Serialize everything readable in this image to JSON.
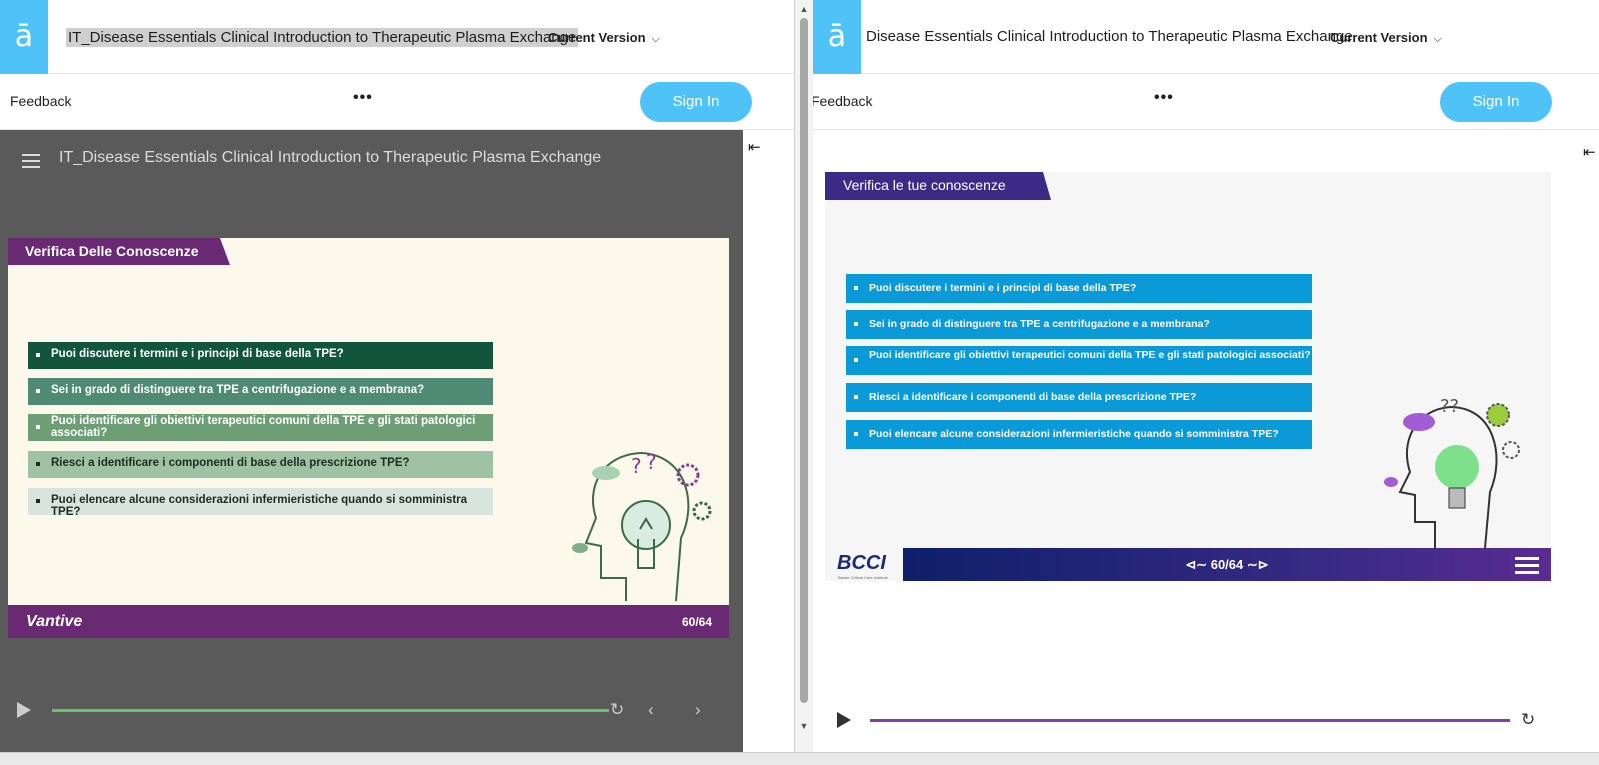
{
  "left": {
    "title": "IT_Disease Essentials Clinical Introduction to Therapeutic Plasma Exchange",
    "version": "Current Version",
    "feedback": "Feedback",
    "more": "•••",
    "sign_in": "Sign In",
    "player_title": "IT_Disease Essentials Clinical Introduction to Therapeutic Plasma Exchange",
    "slide": {
      "heading": "Verifica Delle Conoscenze",
      "questions": [
        "Puoi discutere i termini e i principi di base della TPE?",
        "Sei in grado di distinguere tra TPE a centrifugazione  e a membrana?",
        "Puoi identificare gli obiettivi terapeutici comuni della TPE e gli stati patologici associati?",
        "Riesci a identificare i componenti di base della prescrizione TPE?",
        "Puoi elencare alcune considerazioni infermieristiche quando si somministra TPE?"
      ],
      "question_colors": [
        "#12553d",
        "#4f8a74",
        "#6d9e76",
        "#9ec2a3",
        "#d7e5dc"
      ],
      "question_text_colors": [
        "#ffffff",
        "#ffffff",
        "#ffffff",
        "#1d2d24",
        "#1d2d24"
      ],
      "brand": "Vantive",
      "page": "60/64"
    }
  },
  "right": {
    "title": "Disease Essentials Clinical Introduction to Therapeutic Plasma Exchange",
    "version": "Current Version",
    "feedback": "Feedback",
    "more": "•••",
    "sign_in": "Sign In",
    "slide": {
      "heading": "Verifica le tue conoscenze",
      "questions": [
        "Puoi discutere i termini e i principi di base della TPE?",
        "Sei in grado di distinguere tra TPE a centrifugazione  e a membrana?",
        "Puoi identificare gli obiettivi terapeutici comuni della TPE e gli stati patologici associati?",
        "Riesci a identificare i componenti di base della prescrizione TPE?",
        "Puoi elencare alcune considerazioni infermieristiche quando si somministra TPE?"
      ],
      "brand": "BCCI",
      "brand_sub": "Baxter Critical Care Institute",
      "page": "60/64"
    }
  },
  "colors": {
    "accent": "#4fc3f7",
    "left_tab": "#6a2a73",
    "right_tab": "#3b2b86",
    "right_question": "#0a9ad8"
  },
  "icons": [
    "logo-icon",
    "chevron-down-icon",
    "collapse-panel-icon",
    "menu-icon",
    "play-icon",
    "replay-icon",
    "prev-icon",
    "next-icon",
    "hamburger-icon"
  ]
}
